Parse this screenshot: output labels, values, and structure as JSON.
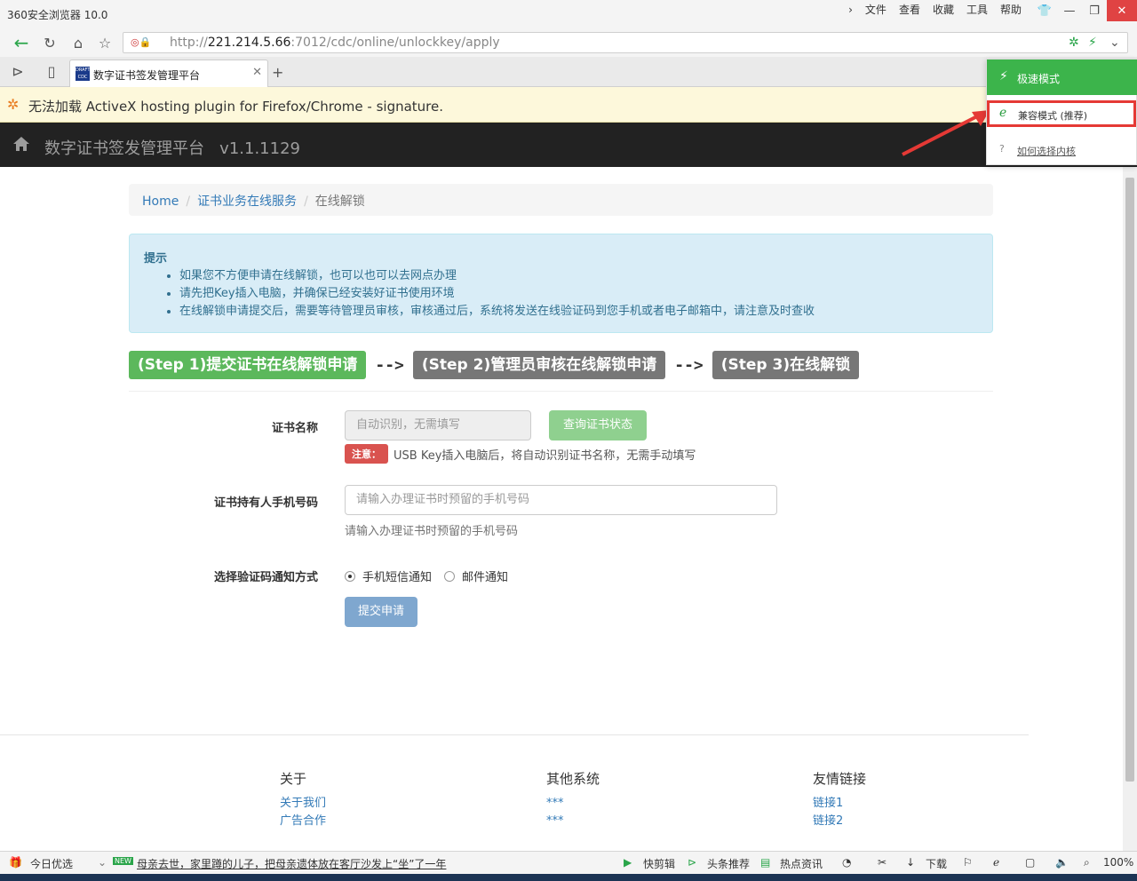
{
  "browser": {
    "app_title": "360安全浏览器 10.0",
    "menu": [
      "文件",
      "查看",
      "收藏",
      "工具",
      "帮助"
    ],
    "url_prefix": "http://",
    "url_host": "221.214.5.66",
    "url_path": ":7012/cdc/online/unlockkey/apply",
    "tab_title": "数字证书签发管理平台",
    "tab_favicon_text": "DRAFT CDC",
    "warning": "无法加载 ActiveX hosting plugin for Firefox/Chrome - signature."
  },
  "engine_popup": {
    "fast_mode": "极速模式",
    "compat_mode": "兼容模式 (推荐)",
    "how_to": "如何选择内核"
  },
  "navbar": {
    "brand": "数字证书签发管理平台",
    "version": "v1.1.1129"
  },
  "breadcrumb": {
    "home": "Home",
    "section": "证书业务在线服务",
    "current": "在线解锁"
  },
  "alert": {
    "heading": "提示",
    "items": [
      "如果您不方便申请在线解锁，也可以也可以去网点办理",
      "请先把Key插入电脑，并确保已经安装好证书使用环境",
      "在线解锁申请提交后，需要等待管理员审核，审核通过后，系统将发送在线验证码到您手机或者电子邮箱中，请注意及时查收"
    ]
  },
  "steps": {
    "step1": "(Step 1)提交证书在线解锁申请",
    "step2": "(Step 2)管理员审核在线解锁申请",
    "step3": "(Step 3)在线解锁",
    "arrow": "-->"
  },
  "form": {
    "cert_name_label": "证书名称",
    "cert_name_placeholder": "自动识别，无需填写",
    "query_button": "查询证书状态",
    "note_label": "注意：",
    "note_text": "USB Key插入电脑后，将自动识别证书名称，无需手动填写",
    "phone_label": "证书持有人手机号码",
    "phone_placeholder": "请输入办理证书时预留的手机号码",
    "phone_help": "请输入办理证书时预留的手机号码",
    "notify_label": "选择验证码通知方式",
    "notify_sms": "手机短信通知",
    "notify_email": "邮件通知",
    "notify_selected": "sms",
    "submit": "提交申请"
  },
  "footer": {
    "col1": {
      "title": "关于",
      "links": [
        "关于我们",
        "广告合作"
      ]
    },
    "col2": {
      "title": "其他系统",
      "links": [
        "***",
        "***"
      ]
    },
    "col3": {
      "title": "友情链接",
      "links": [
        "链接1",
        "链接2"
      ]
    }
  },
  "statusbar": {
    "today": "今日优选",
    "news_badge": "NEW",
    "news": "母亲去世，家里蹲的儿子，把母亲遗体放在客厅沙发上“坐”了一年",
    "quick_edit": "快剪辑",
    "headlines": "头条推荐",
    "hot": "热点资讯",
    "download": "下载",
    "zoom": "100%"
  },
  "colors": {
    "step_active": "#5cb85c",
    "step_inactive": "#777777",
    "navbar_bg": "#222222",
    "alert_bg": "#d9edf7",
    "popup_green": "#3cb44b",
    "highlight_red": "#e53935"
  }
}
